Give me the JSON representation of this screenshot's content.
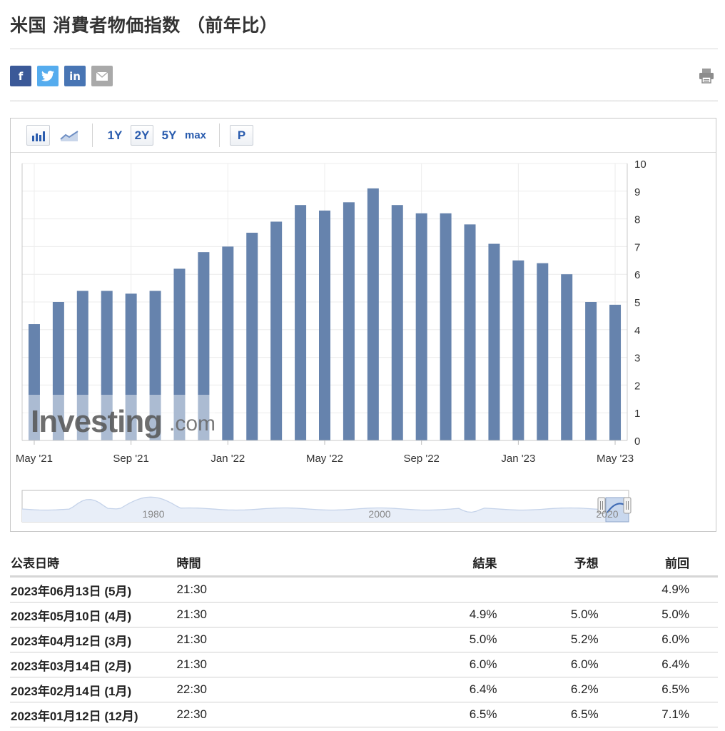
{
  "page": {
    "title": "米国 消費者物価指数 （前年比）"
  },
  "share": {
    "items": [
      {
        "name": "facebook",
        "label": "f",
        "color": "#3b5998"
      },
      {
        "name": "twitter",
        "label": "",
        "color": "#55acee"
      },
      {
        "name": "linkedin",
        "label": "in",
        "color": "#4875b4"
      },
      {
        "name": "email",
        "label": "",
        "color": "#a9a9a9"
      }
    ],
    "print_icon": "printer-icon"
  },
  "toolbar": {
    "bar_icon": "bar-chart-icon",
    "line_icon": "line-chart-icon",
    "range_1y": "1Y",
    "range_2y": "2Y",
    "range_5y": "5Y",
    "range_max": "max",
    "p_label": "P",
    "active_range": "2Y"
  },
  "chart_data": {
    "type": "bar",
    "categories": [
      "May '21",
      "Jun '21",
      "Jul '21",
      "Aug '21",
      "Sep '21",
      "Oct '21",
      "Nov '21",
      "Dec '21",
      "Jan '22",
      "Feb '22",
      "Mar '22",
      "Apr '22",
      "May '22",
      "Jun '22",
      "Jul '22",
      "Aug '22",
      "Sep '22",
      "Oct '22",
      "Nov '22",
      "Dec '22",
      "Jan '23",
      "Feb '23",
      "Mar '23",
      "Apr '23",
      "May '23"
    ],
    "values": [
      4.2,
      5.0,
      5.4,
      5.4,
      5.3,
      5.4,
      6.2,
      6.8,
      7.0,
      7.5,
      7.9,
      8.5,
      8.3,
      8.6,
      9.1,
      8.5,
      8.2,
      8.2,
      7.8,
      7.1,
      6.5,
      6.4,
      6.0,
      5.0,
      4.9
    ],
    "x_tick_labels": [
      "May '21",
      "Sep '21",
      "Jan '22",
      "May '22",
      "Sep '22",
      "Jan '23",
      "May '23"
    ],
    "x_tick_indices": [
      0,
      4,
      8,
      12,
      16,
      20,
      24
    ],
    "y_ticks": [
      "0",
      "1",
      "2",
      "3",
      "4",
      "5",
      "6",
      "7",
      "8",
      "9",
      "10"
    ],
    "ylim": [
      0,
      10
    ],
    "y_axis_side": "right",
    "grid": true,
    "bar_color": "#6683ad",
    "watermark": {
      "brand": "Investing",
      "suffix": ".com"
    },
    "navigator": {
      "labels": [
        "1980",
        "2000",
        "2020"
      ]
    }
  },
  "table": {
    "headers": {
      "date": "公表日時",
      "time": "時間",
      "actual": "結果",
      "forecast": "予想",
      "previous": "前回"
    },
    "rows": [
      {
        "date": "2023年06月13日 (5月)",
        "time": "21:30",
        "actual": "",
        "actual_status": "",
        "forecast": "",
        "previous": "4.9%",
        "previous_status": "up"
      },
      {
        "date": "2023年05月10日 (4月)",
        "time": "21:30",
        "actual": "4.9%",
        "actual_status": "up",
        "forecast": "5.0%",
        "previous": "5.0%",
        "previous_status": ""
      },
      {
        "date": "2023年04月12日 (3月)",
        "time": "21:30",
        "actual": "5.0%",
        "actual_status": "up",
        "forecast": "5.2%",
        "previous": "6.0%",
        "previous_status": ""
      },
      {
        "date": "2023年03月14日 (2月)",
        "time": "21:30",
        "actual": "6.0%",
        "actual_status": "",
        "forecast": "6.0%",
        "previous": "6.4%",
        "previous_status": ""
      },
      {
        "date": "2023年02月14日 (1月)",
        "time": "22:30",
        "actual": "6.4%",
        "actual_status": "down",
        "forecast": "6.2%",
        "previous": "6.5%",
        "previous_status": ""
      },
      {
        "date": "2023年01月12日 (12月)",
        "time": "22:30",
        "actual": "6.5%",
        "actual_status": "",
        "forecast": "6.5%",
        "previous": "7.1%",
        "previous_status": ""
      }
    ]
  }
}
